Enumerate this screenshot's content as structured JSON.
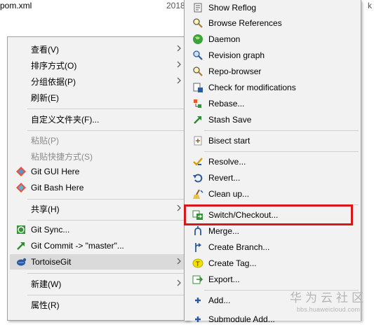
{
  "background": {
    "file_name": "pom.xml",
    "date_fragment": "2018",
    "size_fragment": "k"
  },
  "main_menu": {
    "items": [
      {
        "label": "查看(V)"
      },
      {
        "label": "排序方式(O)"
      },
      {
        "label": "分组依据(P)"
      },
      {
        "label": "刷新(E)"
      },
      {
        "label": "自定义文件夹(F)..."
      },
      {
        "label": "粘贴(P)"
      },
      {
        "label": "粘贴快捷方式(S)"
      },
      {
        "label": "Git GUI Here"
      },
      {
        "label": "Git Bash Here"
      },
      {
        "label": "共享(H)"
      },
      {
        "label": "Git Sync..."
      },
      {
        "label": "Git Commit -> \"master\"..."
      },
      {
        "label": "TortoiseGit"
      },
      {
        "label": "新建(W)"
      },
      {
        "label": "属性(R)"
      }
    ]
  },
  "sub_menu": {
    "items": [
      {
        "label": "Show Reflog"
      },
      {
        "label": "Browse References"
      },
      {
        "label": "Daemon"
      },
      {
        "label": "Revision graph"
      },
      {
        "label": "Repo-browser"
      },
      {
        "label": "Check for modifications"
      },
      {
        "label": "Rebase..."
      },
      {
        "label": "Stash Save"
      },
      {
        "label": "Bisect start"
      },
      {
        "label": "Resolve..."
      },
      {
        "label": "Revert..."
      },
      {
        "label": "Clean up..."
      },
      {
        "label": "Switch/Checkout..."
      },
      {
        "label": "Merge..."
      },
      {
        "label": "Create Branch..."
      },
      {
        "label": "Create Tag..."
      },
      {
        "label": "Export..."
      },
      {
        "label": "Add..."
      },
      {
        "label": "Submodule Add..."
      }
    ]
  },
  "highlight_color": "#d6171c",
  "watermark": {
    "title": "华为云社区",
    "url": "bbs.huaweicloud.com"
  }
}
